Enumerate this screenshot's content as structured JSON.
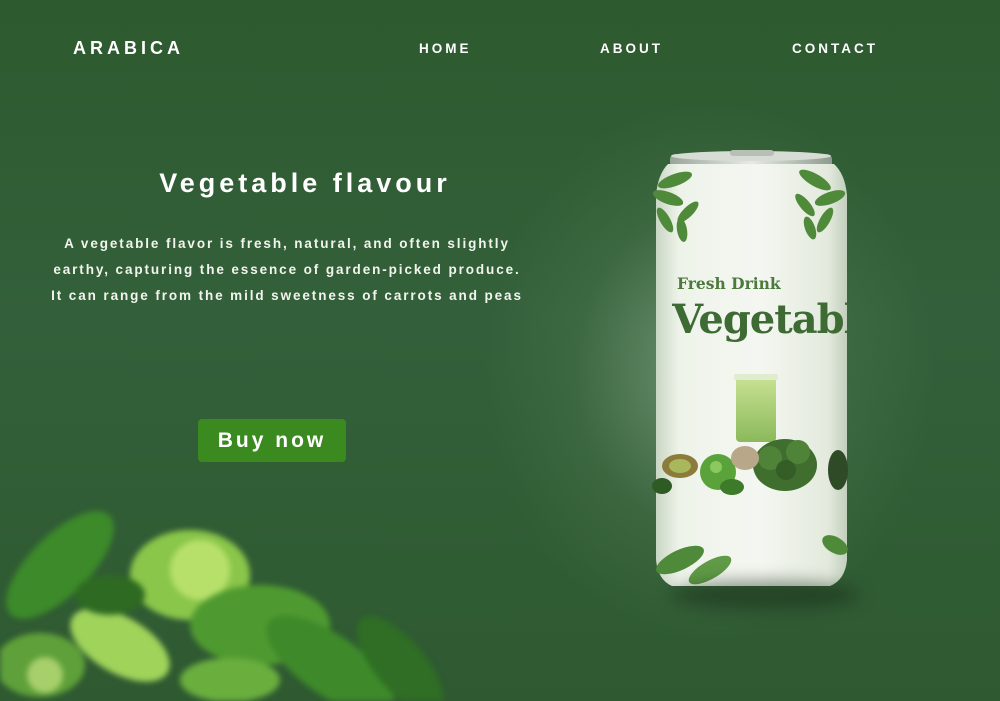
{
  "header": {
    "brand": "ARABICA",
    "nav": {
      "home": "HOME",
      "about": "ABOUT",
      "contact": "CONTACT"
    }
  },
  "hero": {
    "title": "Vegetable flavour",
    "description": "A vegetable flavor is fresh, natural, and often slightly earthy, capturing the essence of garden-picked produce. It can range from the mild sweetness of carrots and peas",
    "cta_label": "Buy now"
  },
  "product_can": {
    "line1": "Fresh Drink",
    "line2": "Vegetable"
  },
  "colors": {
    "background": "#2f5a31",
    "button": "#3b8a1f",
    "can_body": "#e8efe2",
    "can_text": "#3d6b33"
  },
  "icons": {
    "can": "beverage-can-image",
    "foliage": "blurred-greens-image"
  }
}
